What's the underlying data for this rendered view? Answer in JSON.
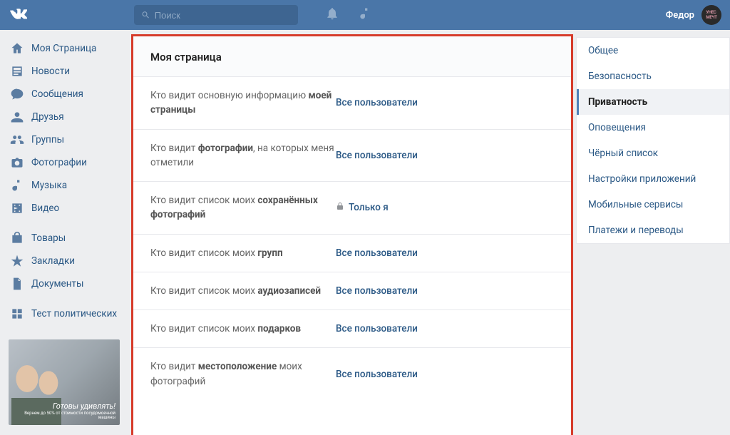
{
  "header": {
    "search_placeholder": "Поиск",
    "username": "Федор"
  },
  "leftnav": {
    "items": [
      {
        "icon": "home",
        "label": "Моя Страница"
      },
      {
        "icon": "news",
        "label": "Новости"
      },
      {
        "icon": "msg",
        "label": "Сообщения"
      },
      {
        "icon": "user",
        "label": "Друзья"
      },
      {
        "icon": "group",
        "label": "Группы"
      },
      {
        "icon": "photo",
        "label": "Фотографии"
      },
      {
        "icon": "music",
        "label": "Музыка"
      },
      {
        "icon": "video",
        "label": "Видео"
      }
    ],
    "items2": [
      {
        "icon": "bag",
        "label": "Товары"
      },
      {
        "icon": "star",
        "label": "Закладки"
      },
      {
        "icon": "doc",
        "label": "Документы"
      }
    ],
    "items3": [
      {
        "icon": "grid",
        "label": "Тест политических"
      }
    ],
    "ad": {
      "headline": "Готовы удивлять!",
      "sub": "Вернем до 50% от стоимости посудомоечной машины"
    }
  },
  "panel": {
    "title": "Моя страница",
    "rows": [
      {
        "label_pre": "Кто видит основную информацию ",
        "label_b": "моей страницы",
        "label_post": "",
        "value": "Все пользователи",
        "locked": false
      },
      {
        "label_pre": "Кто видит ",
        "label_b": "фотографии",
        "label_post": ", на которых меня отметили",
        "value": "Все пользователи",
        "locked": false
      },
      {
        "label_pre": "Кто видит список моих ",
        "label_b": "сохранённых фотографий",
        "label_post": "",
        "value": "Только я",
        "locked": true
      },
      {
        "label_pre": "Кто видит список моих ",
        "label_b": "групп",
        "label_post": "",
        "value": "Все пользователи",
        "locked": false
      },
      {
        "label_pre": "Кто видит список моих ",
        "label_b": "аудиозаписей",
        "label_post": "",
        "value": "Все пользователи",
        "locked": false
      },
      {
        "label_pre": "Кто видит список моих ",
        "label_b": "подарков",
        "label_post": "",
        "value": "Все пользователи",
        "locked": false
      },
      {
        "label_pre": "Кто видит ",
        "label_b": "местоположение",
        "label_post": " моих фотографий",
        "value": "Все пользователи",
        "locked": false
      }
    ]
  },
  "tabs": [
    {
      "label": "Общее",
      "active": false
    },
    {
      "label": "Безопасность",
      "active": false
    },
    {
      "label": "Приватность",
      "active": true
    },
    {
      "label": "Оповещения",
      "active": false
    },
    {
      "label": "Чёрный список",
      "active": false
    },
    {
      "label": "Настройки приложений",
      "active": false
    },
    {
      "label": "Мобильные сервисы",
      "active": false
    },
    {
      "label": "Платежи и переводы",
      "active": false
    }
  ]
}
